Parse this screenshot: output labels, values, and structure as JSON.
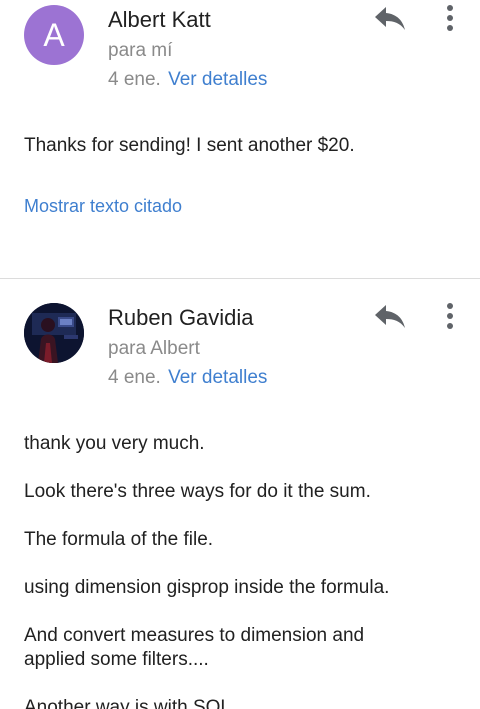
{
  "messages": [
    {
      "avatar_letter": "A",
      "avatar_color": "#9c73d3",
      "sender": "Albert Katt",
      "recipient": "para mí",
      "date": "4 ene.",
      "details_link": "Ver detalles",
      "body": [
        "Thanks for sending! I sent another $20."
      ],
      "quoted_link": "Mostrar texto citado",
      "reply_icon": "reply-icon",
      "more_icon": "more-vert-icon"
    },
    {
      "avatar_type": "photo",
      "sender": "Ruben Gavidia",
      "recipient": "para Albert",
      "date": "4 ene.",
      "details_link": "Ver detalles",
      "body": [
        "thank you very much.",
        "Look there's three ways for do it the sum.",
        "The formula of the file.",
        "using dimension gisprop inside the formula.",
        "And convert measures to dimension and applied some filters....",
        "Another way is with SQL"
      ],
      "reply_icon": "reply-icon",
      "more_icon": "more-vert-icon"
    }
  ],
  "colors": {
    "link": "#3f7fcf",
    "secondary_text": "#8a8a8a",
    "primary_text": "#212121",
    "icon": "#5f6368"
  }
}
